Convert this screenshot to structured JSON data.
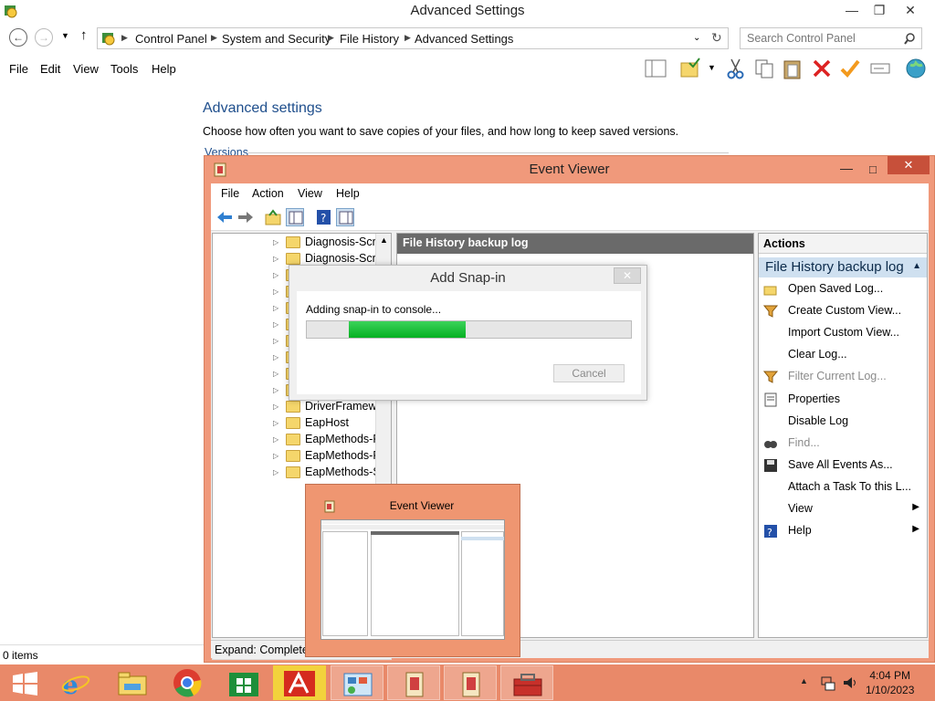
{
  "control_panel": {
    "title": "Advanced Settings",
    "breadcrumbs": [
      "Control Panel",
      "System and Security",
      "File History",
      "Advanced Settings"
    ],
    "search_placeholder": "Search Control Panel",
    "menu": [
      "File",
      "Edit",
      "View",
      "Tools",
      "Help"
    ],
    "heading": "Advanced settings",
    "description": "Choose how often you want to save copies of your files, and how long to keep saved versions.",
    "section_label": "Versions",
    "status": "0 items"
  },
  "event_viewer": {
    "title": "Event Viewer",
    "menu": [
      "File",
      "Action",
      "View",
      "Help"
    ],
    "tree_items": [
      {
        "label": "Diagnosis-Scri",
        "folder": true
      },
      {
        "label": "Diagnosis-Scri",
        "folder": true
      },
      {
        "label": "",
        "folder": true
      },
      {
        "label": "",
        "folder": true
      },
      {
        "label": "",
        "folder": true
      },
      {
        "label": "",
        "folder": true
      },
      {
        "label": "",
        "folder": true
      },
      {
        "label": "",
        "folder": true
      },
      {
        "label": "",
        "folder": true
      },
      {
        "label": "",
        "folder": true
      },
      {
        "label": "DriverFramewo",
        "folder": true
      },
      {
        "label": "EapHost",
        "folder": true
      },
      {
        "label": "EapMethods-R",
        "folder": true
      },
      {
        "label": "EapMethods-R",
        "folder": true
      },
      {
        "label": "EapMethods-S",
        "folder": true
      }
    ],
    "center_header": "File History backup log",
    "actions_header": "Actions",
    "actions_selected": "File History backup log",
    "actions": [
      {
        "label": "Open Saved Log...",
        "icon": "folder-open-icon"
      },
      {
        "label": "Create Custom View...",
        "icon": "filter-icon"
      },
      {
        "label": "Import Custom View...",
        "icon": ""
      },
      {
        "label": "Clear Log...",
        "icon": ""
      },
      {
        "label": "Filter Current Log...",
        "icon": "filter-icon"
      },
      {
        "label": "Properties",
        "icon": "properties-icon"
      },
      {
        "label": "Disable Log",
        "icon": ""
      },
      {
        "label": "Find...",
        "icon": "find-icon"
      },
      {
        "label": "Save All Events As...",
        "icon": "save-icon"
      },
      {
        "label": "Attach a Task To this L...",
        "icon": ""
      },
      {
        "label": "View",
        "icon": "",
        "submenu": true
      },
      {
        "label": "Help",
        "icon": "help-icon",
        "submenu": true
      }
    ],
    "status": "Expand: Completed"
  },
  "snapin_dialog": {
    "title": "Add Snap-in",
    "message": "Adding snap-in to console...",
    "progress": 0.36,
    "progress_start": 0.13,
    "cancel_label": "Cancel"
  },
  "thumbnail": {
    "title": "Event Viewer"
  },
  "taskbar": {
    "time": "4:04 PM",
    "date": "1/10/2023"
  },
  "colors": {
    "accent": "#e98969",
    "window_frame": "#f0997b",
    "progress_green": "#06b025",
    "link_blue": "#1e4e8c"
  }
}
